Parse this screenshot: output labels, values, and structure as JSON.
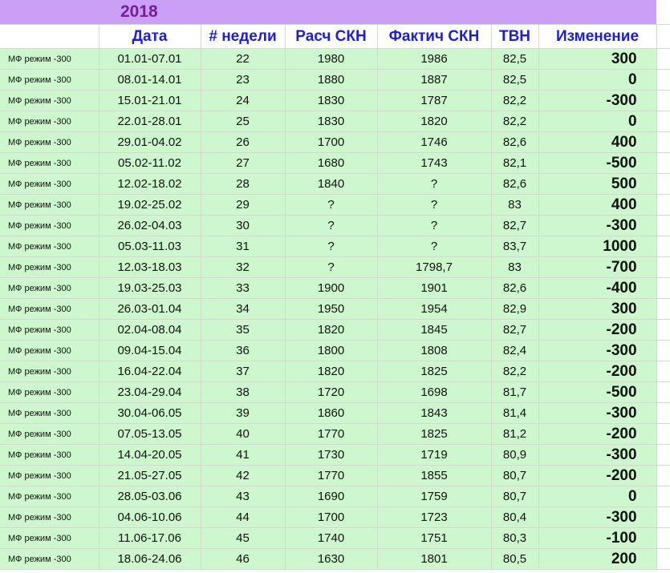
{
  "header": {
    "year": "2018",
    "columns": [
      "",
      "Дата",
      "# недели",
      "Расч СКН",
      "Фактич СКН",
      "ТВН",
      "Изменение"
    ]
  },
  "rows": [
    {
      "label": "МФ режим -300",
      "date": "01.01-07.01",
      "week": "22",
      "calc": "1980",
      "fact": "1986",
      "tvn": "82,5",
      "change": "300"
    },
    {
      "label": "МФ режим -300",
      "date": "08.01-14.01",
      "week": "23",
      "calc": "1880",
      "fact": "1887",
      "tvn": "82,5",
      "change": "0"
    },
    {
      "label": "МФ режим -300",
      "date": "15.01-21.01",
      "week": "24",
      "calc": "1830",
      "fact": "1787",
      "tvn": "82,2",
      "change": "-300"
    },
    {
      "label": "МФ режим -300",
      "date": "22.01-28.01",
      "week": "25",
      "calc": "1830",
      "fact": "1820",
      "tvn": "82,2",
      "change": "0"
    },
    {
      "label": "МФ режим -300",
      "date": "29.01-04.02",
      "week": "26",
      "calc": "1700",
      "fact": "1746",
      "tvn": "82,6",
      "change": "400"
    },
    {
      "label": "МФ режим -300",
      "date": "05.02-11.02",
      "week": "27",
      "calc": "1680",
      "fact": "1743",
      "tvn": "82,1",
      "change": "-500"
    },
    {
      "label": "МФ режим -300",
      "date": "12.02-18.02",
      "week": "28",
      "calc": "1840",
      "fact": "?",
      "tvn": "82,6",
      "change": "500"
    },
    {
      "label": "МФ режим -300",
      "date": "19.02-25.02",
      "week": "29",
      "calc": "?",
      "fact": "?",
      "tvn": "83",
      "change": "400"
    },
    {
      "label": "МФ режим -300",
      "date": "26.02-04.03",
      "week": "30",
      "calc": "?",
      "fact": "?",
      "tvn": "82,7",
      "change": "-300"
    },
    {
      "label": "МФ режим -300",
      "date": "05.03-11.03",
      "week": "31",
      "calc": "?",
      "fact": "?",
      "tvn": "83,7",
      "change": "1000"
    },
    {
      "label": "МФ режим -300",
      "date": "12.03-18.03",
      "week": "32",
      "calc": "?",
      "fact": "1798,7",
      "tvn": "83",
      "change": "-700"
    },
    {
      "label": "МФ режим -300",
      "date": "19.03-25.03",
      "week": "33",
      "calc": "1900",
      "fact": "1901",
      "tvn": "82,6",
      "change": "-400"
    },
    {
      "label": "МФ режим -300",
      "date": "26.03-01.04",
      "week": "34",
      "calc": "1950",
      "fact": "1954",
      "tvn": "82,9",
      "change": "300"
    },
    {
      "label": "МФ режим -300",
      "date": "02.04-08.04",
      "week": "35",
      "calc": "1820",
      "fact": "1845",
      "tvn": "82,7",
      "change": "-200"
    },
    {
      "label": "МФ режим -300",
      "date": "09.04-15.04",
      "week": "36",
      "calc": "1800",
      "fact": "1808",
      "tvn": "82,4",
      "change": "-300"
    },
    {
      "label": "МФ режим -300",
      "date": "16.04-22.04",
      "week": "37",
      "calc": "1820",
      "fact": "1825",
      "tvn": "82,2",
      "change": "-200"
    },
    {
      "label": "МФ режим -300",
      "date": "23.04-29.04",
      "week": "38",
      "calc": "1720",
      "fact": "1698",
      "tvn": "81,7",
      "change": "-500"
    },
    {
      "label": "МФ режим -300",
      "date": "30.04-06.05",
      "week": "39",
      "calc": "1860",
      "fact": "1843",
      "tvn": "81,4",
      "change": "-300"
    },
    {
      "label": "МФ режим -300",
      "date": "07.05-13.05",
      "week": "40",
      "calc": "1770",
      "fact": "1825",
      "tvn": "81,2",
      "change": "-200"
    },
    {
      "label": "МФ режим -300",
      "date": "14.04-20.05",
      "week": "41",
      "calc": "1730",
      "fact": "1719",
      "tvn": "80,9",
      "change": "-300"
    },
    {
      "label": "МФ режим -300",
      "date": "21.05-27.05",
      "week": "42",
      "calc": "1770",
      "fact": "1855",
      "tvn": "80,7",
      "change": "-200"
    },
    {
      "label": "МФ режим -300",
      "date": "28.05-03.06",
      "week": "43",
      "calc": "1690",
      "fact": "1759",
      "tvn": "80,7",
      "change": "0"
    },
    {
      "label": "МФ режим -300",
      "date": "04.06-10.06",
      "week": "44",
      "calc": "1700",
      "fact": "1723",
      "tvn": "80,4",
      "change": "-300"
    },
    {
      "label": "МФ режим -300",
      "date": "11.06-17.06",
      "week": "45",
      "calc": "1740",
      "fact": "1751",
      "tvn": "80,3",
      "change": "-100"
    },
    {
      "label": "МФ режим -300",
      "date": "18.06-24.06",
      "week": "46",
      "calc": "1630",
      "fact": "1801",
      "tvn": "80,5",
      "change": "200"
    }
  ],
  "colors": {
    "header_band": "#c9a0f5",
    "year_text": "#7a1aa0",
    "header_text": "#1c1ce6",
    "row_fill": "#cdf7cc",
    "positive": "#e10f0f",
    "negative": "#2e8b57"
  }
}
